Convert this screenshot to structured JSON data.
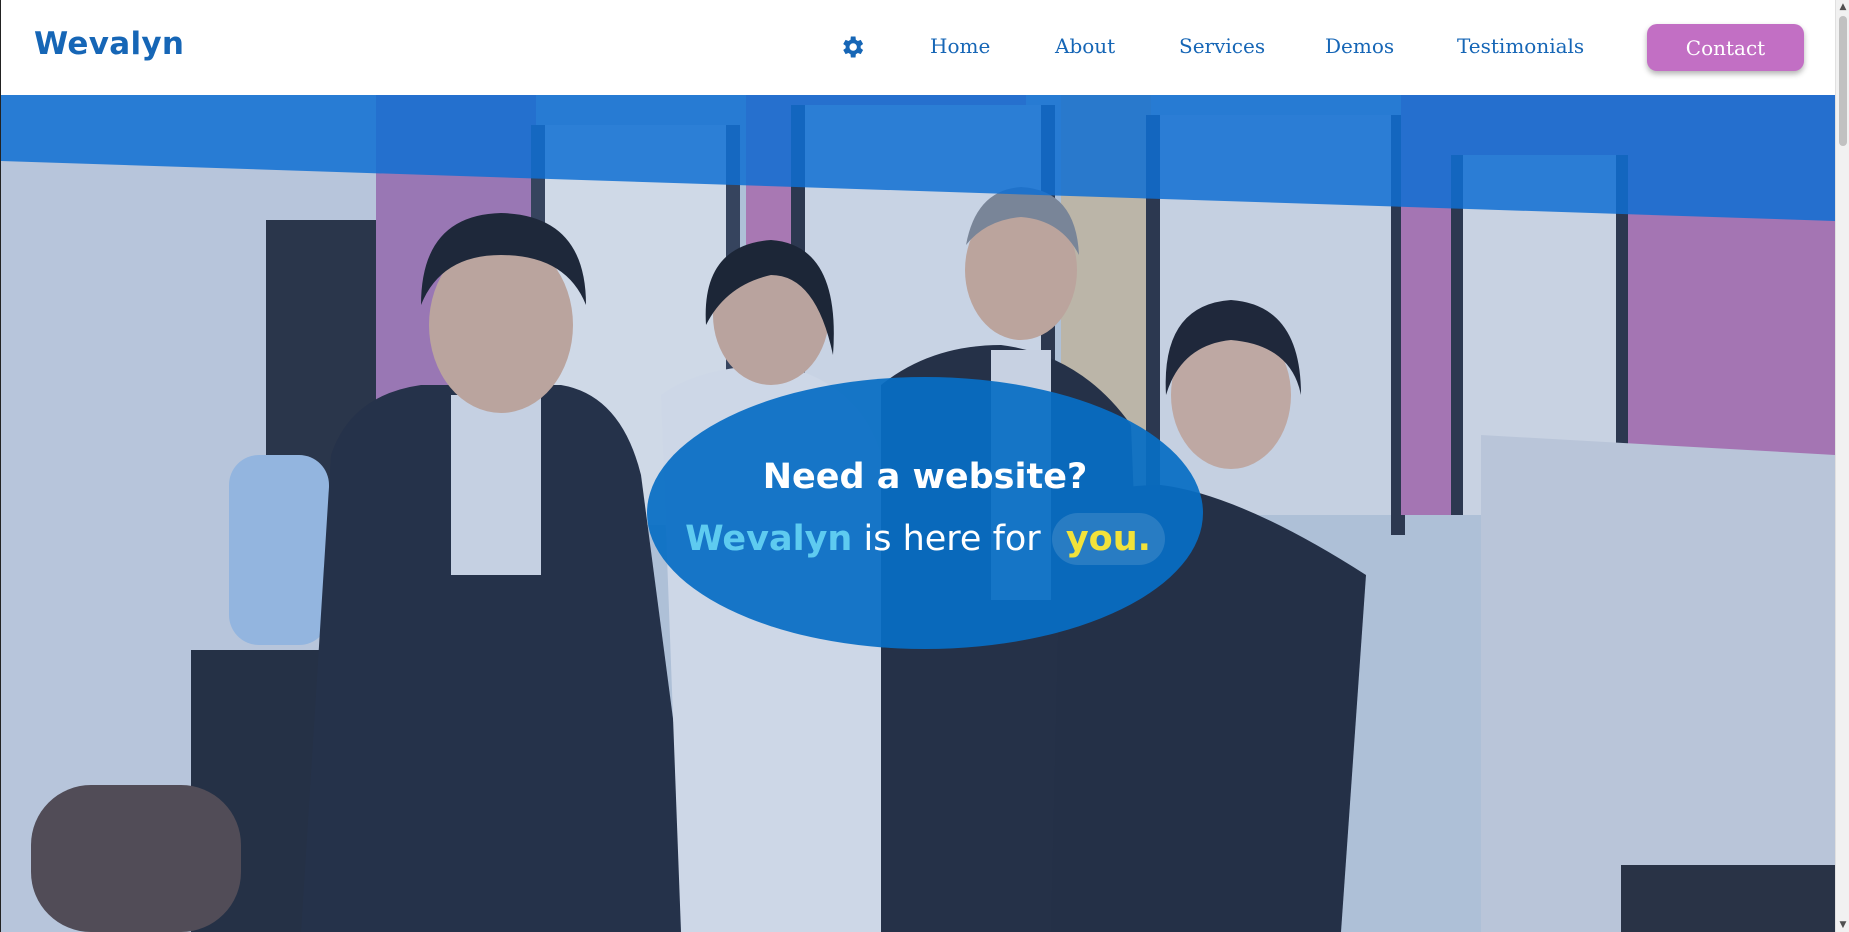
{
  "header": {
    "brand": "Wevalyn",
    "settings_icon": "gear-icon",
    "nav": [
      {
        "label": "Home"
      },
      {
        "label": "About"
      },
      {
        "label": "Services"
      },
      {
        "label": "Demos"
      },
      {
        "label": "Testimonials"
      }
    ],
    "contact_label": "Contact"
  },
  "hero": {
    "headline": "Need a website?",
    "sub_brand": "Wevalyn",
    "sub_middle": "is here for",
    "sub_highlight": "you."
  },
  "colors": {
    "brand_blue": "#1666b6",
    "contact_button": "#c26fc4",
    "oval": "#086ec4",
    "accent_cyan": "#5ecbf0",
    "highlight_yellow": "#f2e23a"
  }
}
